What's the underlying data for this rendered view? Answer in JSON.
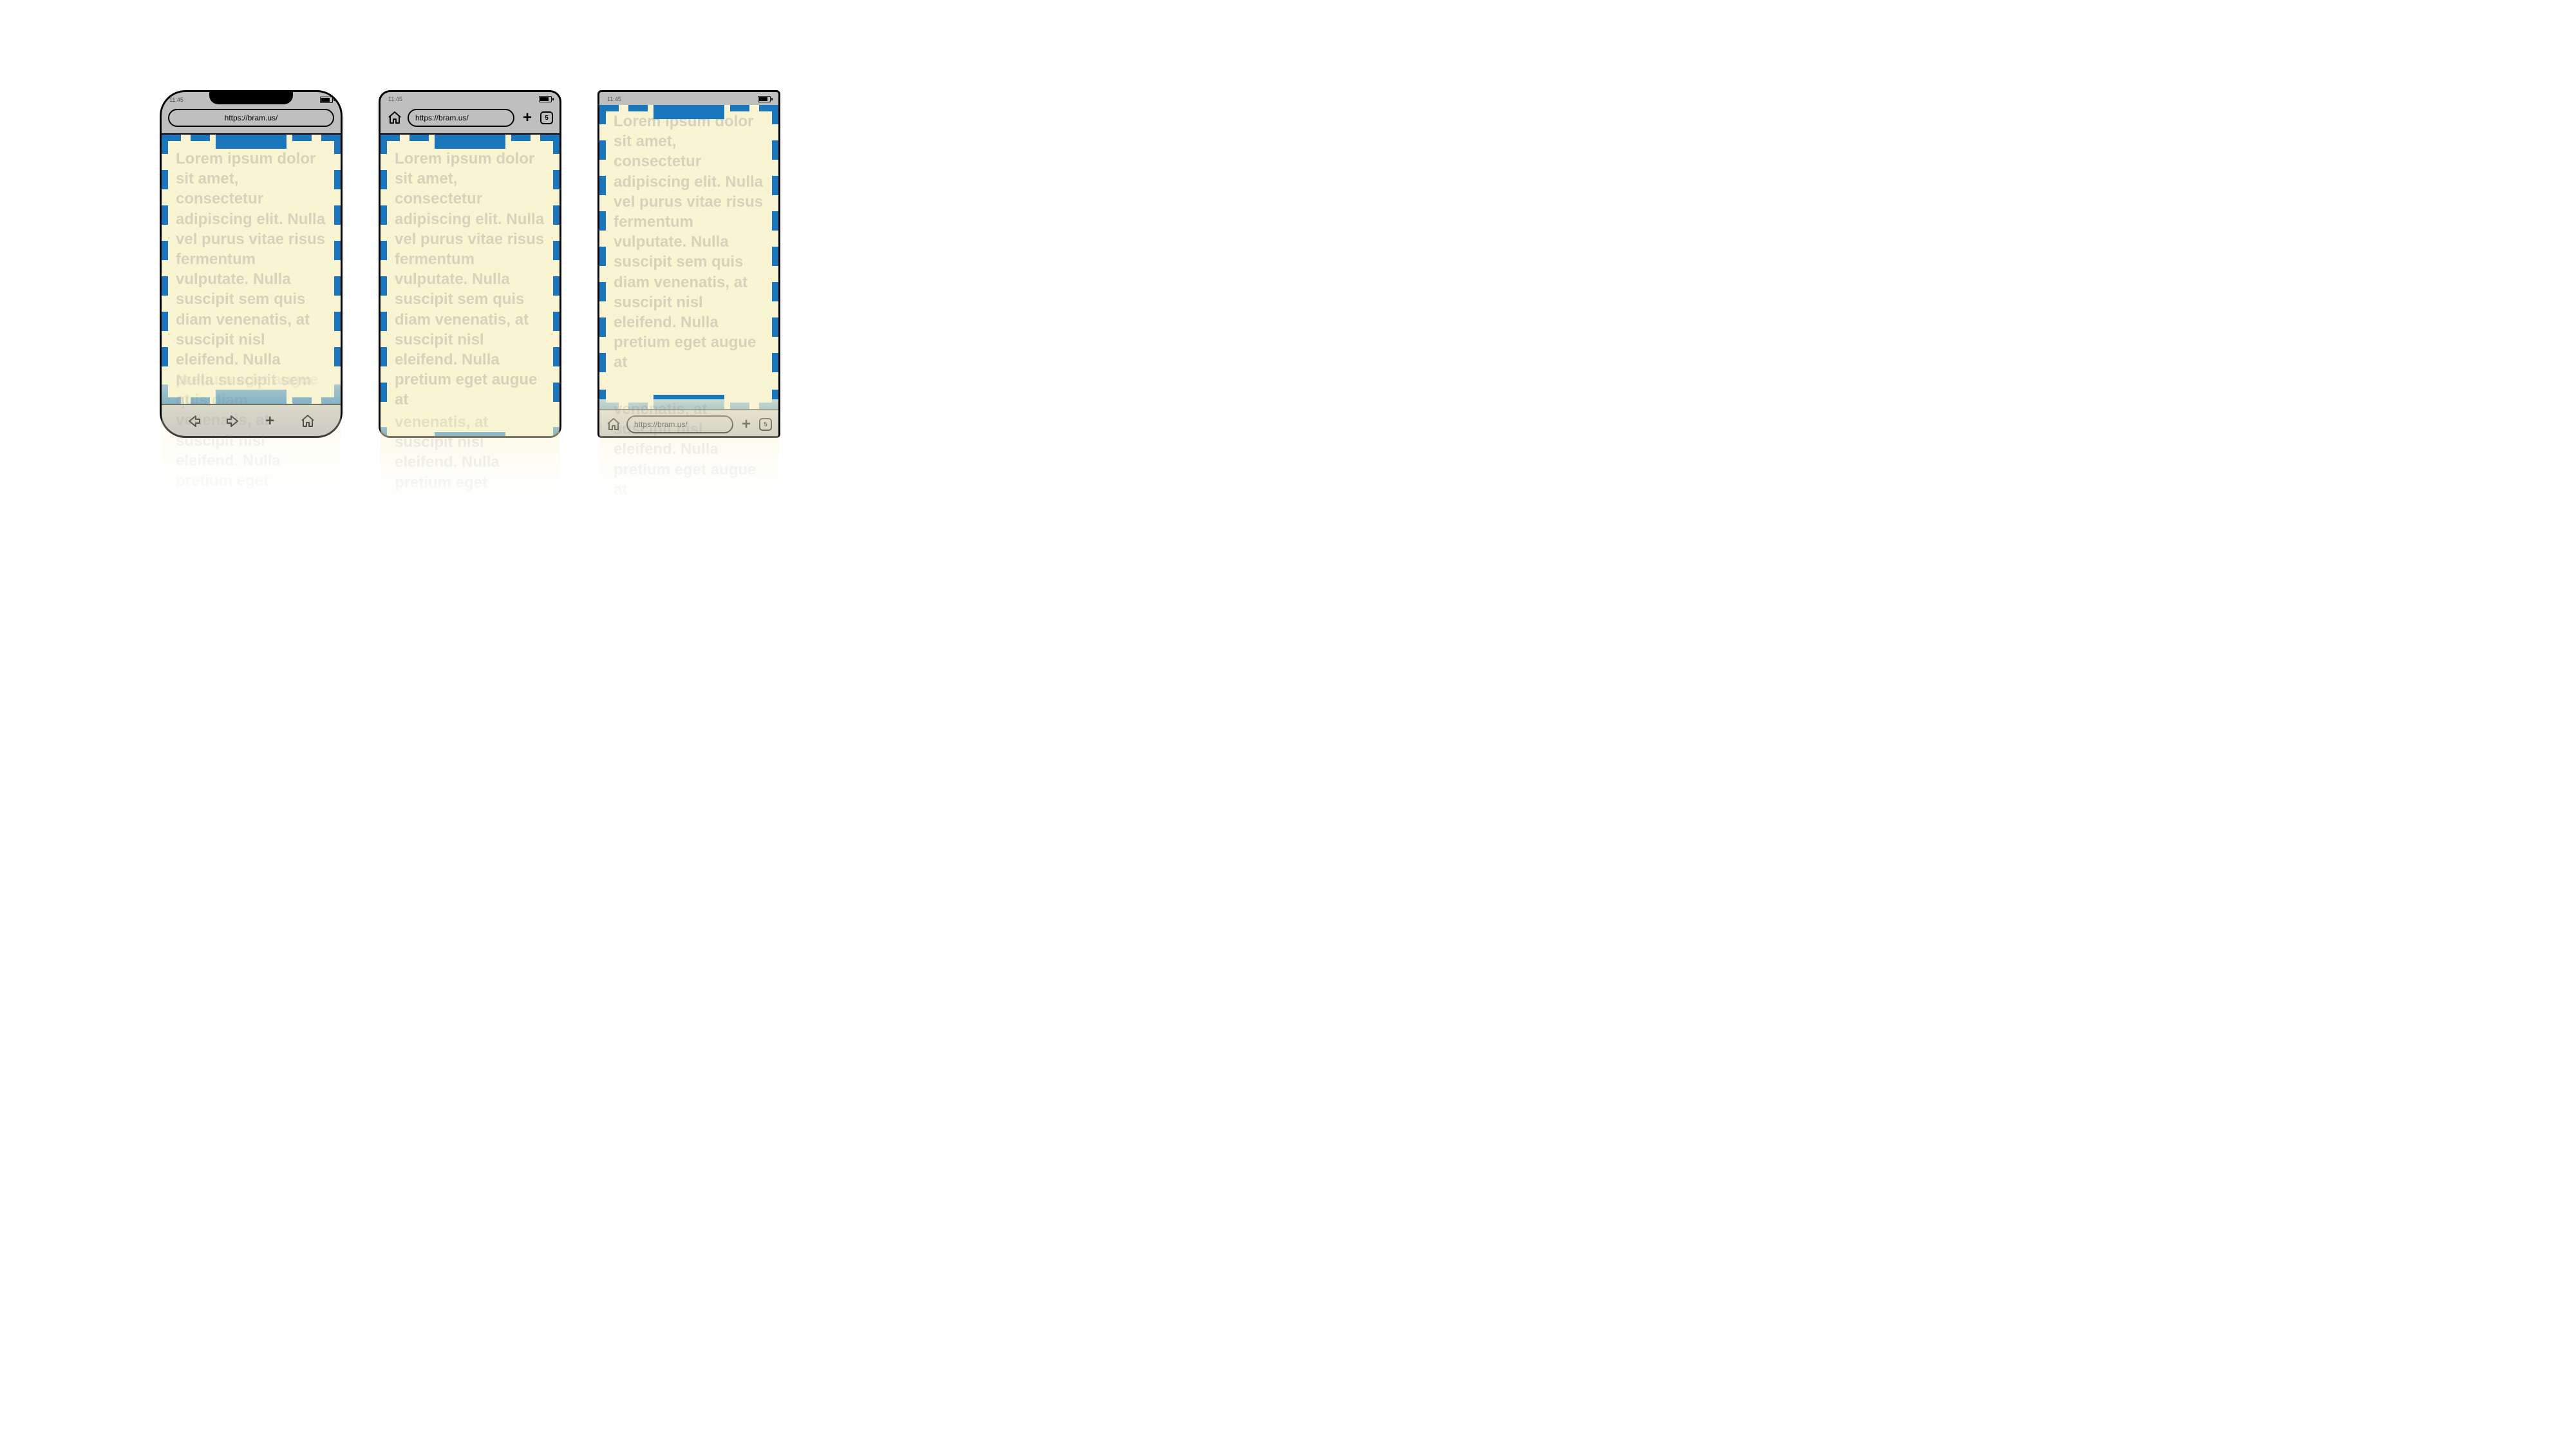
{
  "time": "11:45",
  "url": "https://bram.us/",
  "tab_count": "5",
  "lorem": "Lorem ipsum dolor sit amet, consectetur adipiscing elit. Nulla vel purus vitae risus fermentum vulputate. Nulla suscipit sem quis diam venenatis, at suscipit nisl eleifend. Nulla pretium eget augue at",
  "phones": {
    "a": {
      "style": "rounded-notch",
      "url_position": "top",
      "nav_position": "bottom"
    },
    "b": {
      "style": "rounded",
      "url_position": "top",
      "nav_position": "top"
    },
    "c": {
      "style": "square",
      "url_position": "bottom",
      "nav_position": "bottom"
    }
  },
  "colors": {
    "viewport_bg": "#f9f4d2",
    "chrome_bg": "#bfbfbf",
    "accent_blue": "#1976bd",
    "text_ghost": "rgba(150,150,150,0.35)"
  },
  "overflow": {
    "a": "Nulla suscipit sem quis diam venenatis, at suscipit nisl eleifend. Nulla pretium eget",
    "b": "venenatis, at suscipit nisl eleifend. Nulla pretium eget",
    "c": "venenatis, at suscipit nisl eleifend. Nulla pretium eget augue at"
  }
}
